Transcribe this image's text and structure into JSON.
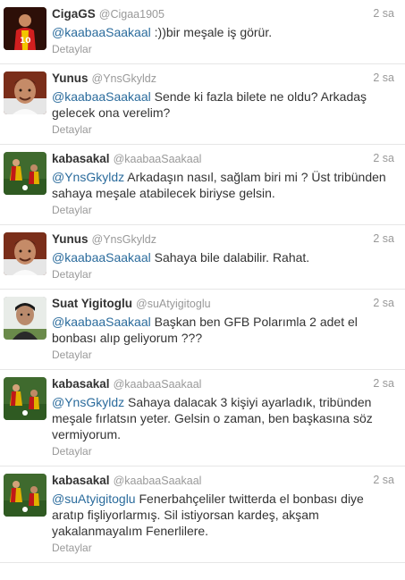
{
  "tweets": [
    {
      "avatar": "avatar-cigags",
      "name": "CigaGS",
      "handle": "@Cigaa1905",
      "time": "2 sa",
      "mention": "@kaabaaSaakaal",
      "text": " :))bir meşale iş görür.",
      "details": "Detaylar"
    },
    {
      "avatar": "avatar-yunus",
      "name": "Yunus",
      "handle": "@YnsGkyldz",
      "time": "2 sa",
      "mention": "@kaabaaSaakaal",
      "text": " Sende ki fazla bilete ne oldu? Arkadaş gelecek ona verelim?",
      "details": "Detaylar"
    },
    {
      "avatar": "avatar-kabasakal",
      "name": "kabasakal",
      "handle": "@kaabaaSaakaal",
      "time": "2 sa",
      "mention": "@YnsGkyldz",
      "text": " Arkadaşın nasıl, sağlam biri mi ? Üst tribünden sahaya meşale atabilecek biriyse gelsin.",
      "details": "Detaylar"
    },
    {
      "avatar": "avatar-yunus",
      "name": "Yunus",
      "handle": "@YnsGkyldz",
      "time": "2 sa",
      "mention": "@kaabaaSaakaal",
      "text": " Sahaya bile dalabilir. Rahat.",
      "details": "Detaylar"
    },
    {
      "avatar": "avatar-suat",
      "name": "Suat Yigitoglu",
      "handle": "@suAtyigitoglu",
      "time": "2 sa",
      "mention": "@kaabaaSaakaal",
      "text": " Başkan ben GFB Polarımla 2 adet el bonbası alıp geliyorum ???",
      "details": "Detaylar"
    },
    {
      "avatar": "avatar-kabasakal",
      "name": "kabasakal",
      "handle": "@kaabaaSaakaal",
      "time": "2 sa",
      "mention": "@YnsGkyldz",
      "text": " Sahaya dalacak 3 kişiyi ayarladık, tribünden meşale fırlatsın yeter. Gelsin o zaman, ben başkasına söz vermiyorum.",
      "details": "Detaylar"
    },
    {
      "avatar": "avatar-kabasakal",
      "name": "kabasakal",
      "handle": "@kaabaaSaakaal",
      "time": "2 sa",
      "mention": "@suAtyigitoglu",
      "text": " Fenerbahçeliler twitterda el bonbası diye aratıp fişliyorlarmış. Sil istiyorsan kardeş, akşam yakalanmayalım Fenerlilere.",
      "details": "Detaylar"
    }
  ],
  "colors": {
    "mention": "#2a6b9c",
    "muted": "#999999",
    "text": "#333333",
    "divider": "#e6e6e6"
  }
}
